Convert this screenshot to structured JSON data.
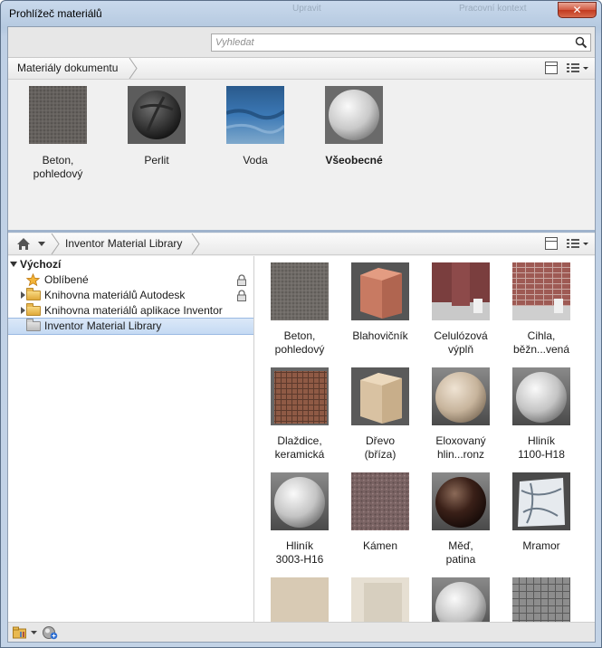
{
  "window": {
    "title": "Prohlížeč materiálů",
    "close_label": "✕",
    "behind_text_1": "Upravit",
    "behind_text_2": "Pracovní kontext"
  },
  "search": {
    "placeholder": "Vyhledat",
    "value": ""
  },
  "document": {
    "breadcrumb": "Materiály dokumentu",
    "materials": [
      {
        "label": "Beton,\npohledový",
        "icon": "concrete-cube",
        "bold": false
      },
      {
        "label": "Perlit",
        "icon": "perlite-sphere",
        "bold": false
      },
      {
        "label": "Voda",
        "icon": "water-swatch",
        "bold": false
      },
      {
        "label": "Všeobecné",
        "icon": "generic-sphere",
        "bold": true
      }
    ]
  },
  "library": {
    "breadcrumb": "Inventor Material Library",
    "home_icon": "home-icon",
    "tree": [
      {
        "label": "Výchozí",
        "level": 0,
        "expanded": true,
        "bold": true,
        "icon": "none",
        "locked": false,
        "selected": false
      },
      {
        "label": "Oblíbené",
        "level": 1,
        "expanded": null,
        "bold": false,
        "icon": "star-icon",
        "locked": true,
        "selected": false
      },
      {
        "label": "Knihovna materiálů Autodesk",
        "level": 1,
        "expanded": false,
        "bold": false,
        "icon": "folder-icon",
        "locked": true,
        "selected": false
      },
      {
        "label": "Knihovna materiálů aplikace Inventor",
        "level": 1,
        "expanded": false,
        "bold": false,
        "icon": "folder-icon",
        "locked": false,
        "selected": false
      },
      {
        "label": "Inventor Material Library",
        "level": 1,
        "expanded": null,
        "bold": false,
        "icon": "folder-gray-icon",
        "locked": false,
        "selected": true
      }
    ],
    "materials": [
      {
        "label": "Beton,\npohledový",
        "icon": "concrete-cube"
      },
      {
        "label": "Blahovičník",
        "icon": "eucalyptus-cube"
      },
      {
        "label": "Celulózová\nvýplň",
        "icon": "cellulose-room"
      },
      {
        "label": "Cihla,\nběžn...vená",
        "icon": "brick-room"
      },
      {
        "label": "Dlaždice,\nkeramická",
        "icon": "tile-cube"
      },
      {
        "label": "Dřevo\n(bříza)",
        "icon": "birch-cube"
      },
      {
        "label": "Eloxovaný\nhlin...ronz",
        "icon": "anodized-sphere"
      },
      {
        "label": "Hliník\n1100-H18",
        "icon": "aluminum-sphere"
      },
      {
        "label": "Hliník\n3003-H16",
        "icon": "aluminum-sphere-2"
      },
      {
        "label": "Kámen",
        "icon": "stone-cube"
      },
      {
        "label": "Měď,\npatina",
        "icon": "copper-sphere"
      },
      {
        "label": "Mramor",
        "icon": "marble-cube"
      },
      {
        "label": "",
        "icon": "sand-cube"
      },
      {
        "label": "",
        "icon": "plaster-room"
      },
      {
        "label": "",
        "icon": "white-sphere"
      },
      {
        "label": "",
        "icon": "grid-cube"
      }
    ]
  },
  "colors": {
    "selection": "#c5daf3",
    "titlebar": "#bfd0e5",
    "close": "#c2391f"
  }
}
